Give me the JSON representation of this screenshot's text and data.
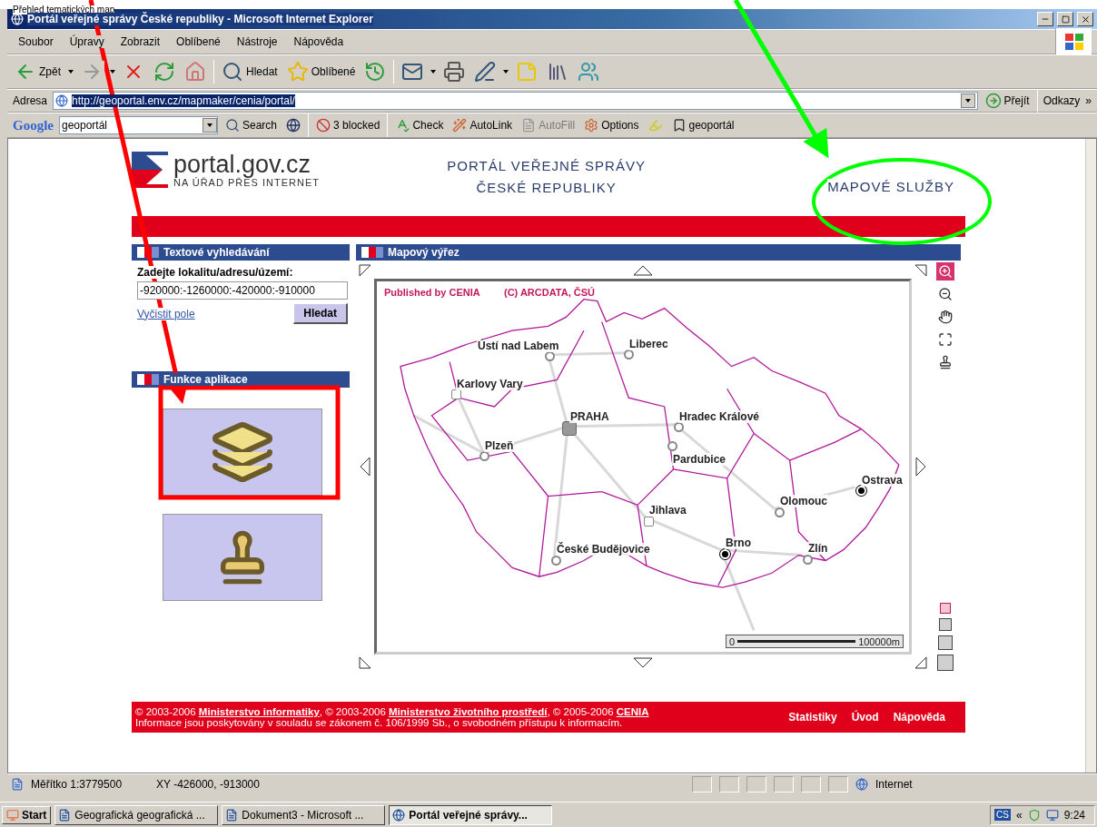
{
  "annotation": {
    "caption": "Přehled tematických map"
  },
  "window": {
    "title": "Portál veřejné správy České republiky - Microsoft Internet Explorer"
  },
  "menu": [
    "Soubor",
    "Úpravy",
    "Zobrazit",
    "Oblíbené",
    "Nástroje",
    "Nápověda"
  ],
  "toolbar": [
    {
      "kind": "back",
      "label": "Zpět",
      "dropdown": true
    },
    {
      "kind": "forward",
      "dropdown": true
    },
    {
      "kind": "stop",
      "dropdown": false
    },
    {
      "kind": "refresh",
      "dropdown": false
    },
    {
      "kind": "home",
      "dropdown": false
    },
    {
      "kind": "search",
      "label": "Hledat",
      "dropdown": false
    },
    {
      "kind": "favorites",
      "label": "Oblíbené",
      "dropdown": false
    },
    {
      "kind": "history",
      "dropdown": false
    },
    {
      "kind": "mail",
      "dropdown": true
    },
    {
      "kind": "print",
      "dropdown": false
    },
    {
      "kind": "edit",
      "dropdown": true
    },
    {
      "kind": "note",
      "dropdown": false
    },
    {
      "kind": "research",
      "dropdown": false
    },
    {
      "kind": "messenger",
      "dropdown": false
    }
  ],
  "address": {
    "label": "Adresa",
    "value": "http://geoportal.env.cz/mapmaker/cenia/portal/",
    "go": "Přejít",
    "links": "Odkazy",
    "more": "»"
  },
  "google_bar": {
    "logo": "Google",
    "query": "geoportál",
    "items": [
      {
        "kind": "search",
        "label": "Search",
        "disabled": false
      },
      {
        "kind": "globe",
        "disabled": false
      },
      {
        "kind": "blocked",
        "label": "3 blocked",
        "disabled": false
      },
      {
        "kind": "check",
        "label": "Check",
        "disabled": false
      },
      {
        "kind": "autolink",
        "label": "AutoLink",
        "disabled": false
      },
      {
        "kind": "autofill",
        "label": "AutoFill",
        "disabled": true
      },
      {
        "kind": "options",
        "label": "Options",
        "disabled": false
      },
      {
        "kind": "highlight",
        "disabled": false
      },
      {
        "kind": "bookmark",
        "label": "geoportál",
        "disabled": false
      }
    ]
  },
  "page": {
    "logo": {
      "name": "portal.gov.cz",
      "tagline": "NA ÚŘAD PŘES INTERNET"
    },
    "title_lines": [
      "PORTÁL VEŘEJNÉ SPRÁVY",
      "ČESKÉ REPUBLIKY"
    ],
    "services": "MAPOVÉ SLUŽBY",
    "search_panel": {
      "heading": "Textové vyhledávání",
      "label": "Zadejte lokalitu/adresu/území:",
      "value": "-920000:-1260000:-420000:-910000",
      "clear_link": "Vyčistit pole",
      "button": "Hledat"
    },
    "functions_panel": {
      "heading": "Funkce aplikace",
      "tiles": [
        {
          "kind": "layers"
        },
        {
          "kind": "stamp"
        }
      ]
    },
    "map_panel": {
      "heading": "Mapový výřez",
      "credit": "Published by CENIA",
      "copyright": "(C) ARCDATA, ČSÚ",
      "cities": [
        {
          "name": "Ústí nad Labem",
          "kind": "city"
        },
        {
          "name": "Liberec",
          "kind": "city"
        },
        {
          "name": "Karlovy Vary",
          "kind": "town"
        },
        {
          "name": "PRAHA",
          "kind": "capital"
        },
        {
          "name": "Hradec Králové",
          "kind": "city"
        },
        {
          "name": "Pardubice",
          "kind": "city"
        },
        {
          "name": "Plzeň",
          "kind": "city"
        },
        {
          "name": "Ostrava",
          "kind": "major"
        },
        {
          "name": "Olomouc",
          "kind": "city"
        },
        {
          "name": "Jihlava",
          "kind": "town"
        },
        {
          "name": "České Budějovice",
          "kind": "city"
        },
        {
          "name": "Brno",
          "kind": "major"
        },
        {
          "name": "Zlín",
          "kind": "city"
        }
      ],
      "scale": {
        "start": "0",
        "end": "100000m"
      },
      "tools": [
        {
          "kind": "zoom-in",
          "selected": true
        },
        {
          "kind": "zoom-out",
          "selected": false
        },
        {
          "kind": "pan",
          "selected": false
        },
        {
          "kind": "extent",
          "selected": false
        },
        {
          "kind": "stamp",
          "selected": false
        }
      ],
      "sizes": [
        {
          "selected": true
        },
        {
          "selected": false
        },
        {
          "selected": false
        },
        {
          "selected": false
        }
      ]
    },
    "footer": {
      "line1": [
        {
          "kind": "text",
          "text": "© 2003-2006 "
        },
        {
          "kind": "link",
          "text": "Ministerstvo informatiky"
        },
        {
          "kind": "text",
          "text": ", © 2003-2006 "
        },
        {
          "kind": "link",
          "text": "Ministerstvo životního prostředí"
        },
        {
          "kind": "text",
          "text": ", © 2005-2006 "
        },
        {
          "kind": "link",
          "text": "CENIA"
        }
      ],
      "line2": "Informace jsou poskytovány v souladu se zákonem č. 106/1999 Sb., o svobodném přístupu k informacím.",
      "nav": [
        "Statistiky",
        "Úvod",
        "Nápověda"
      ]
    }
  },
  "status_bar": {
    "scale": "Měřítko 1:3779500",
    "coords": "XY -426000, -913000",
    "zone": "Internet"
  },
  "taskbar": {
    "start": "Start",
    "tasks": [
      {
        "label": "Geografická geografická ...",
        "kind": "word",
        "selected": false
      },
      {
        "label": "Dokument3 - Microsoft ...",
        "kind": "word",
        "selected": false
      },
      {
        "label": "Portál veřejné správy...",
        "kind": "browser",
        "selected": true
      }
    ],
    "language": "CS",
    "tray_more": "«",
    "time": "9:24"
  }
}
